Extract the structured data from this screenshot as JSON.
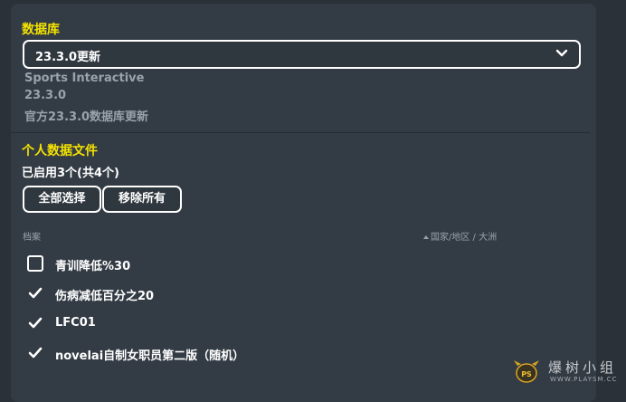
{
  "database": {
    "title": "数据库",
    "selected": "23.3.0更新",
    "publisher": "Sports Interactive",
    "version": "23.3.0",
    "description": "官方23.3.0数据库更新"
  },
  "profile_files": {
    "title": "个人数据文件",
    "enabled_count": "已启用3个(共4个)",
    "select_all_label": "全部选择",
    "remove_all_label": "移除所有",
    "column_file": "档案",
    "column_region": "国家/地区 / 大洲",
    "items": [
      {
        "label": "青训降低%30",
        "checked": false
      },
      {
        "label": "伤病减低百分之20",
        "checked": true
      },
      {
        "label": "LFC01",
        "checked": true
      },
      {
        "label": "novelai自制女职员第二版（随机）",
        "checked": true
      }
    ]
  },
  "watermark": {
    "text": "爆树小组",
    "url": "WWW.PLAYSM.CC",
    "logo_text": "PS"
  },
  "colors": {
    "accent": "#f4e200",
    "panel": "#333b44",
    "background": "#2a3138",
    "muted": "#9aa2ab"
  }
}
